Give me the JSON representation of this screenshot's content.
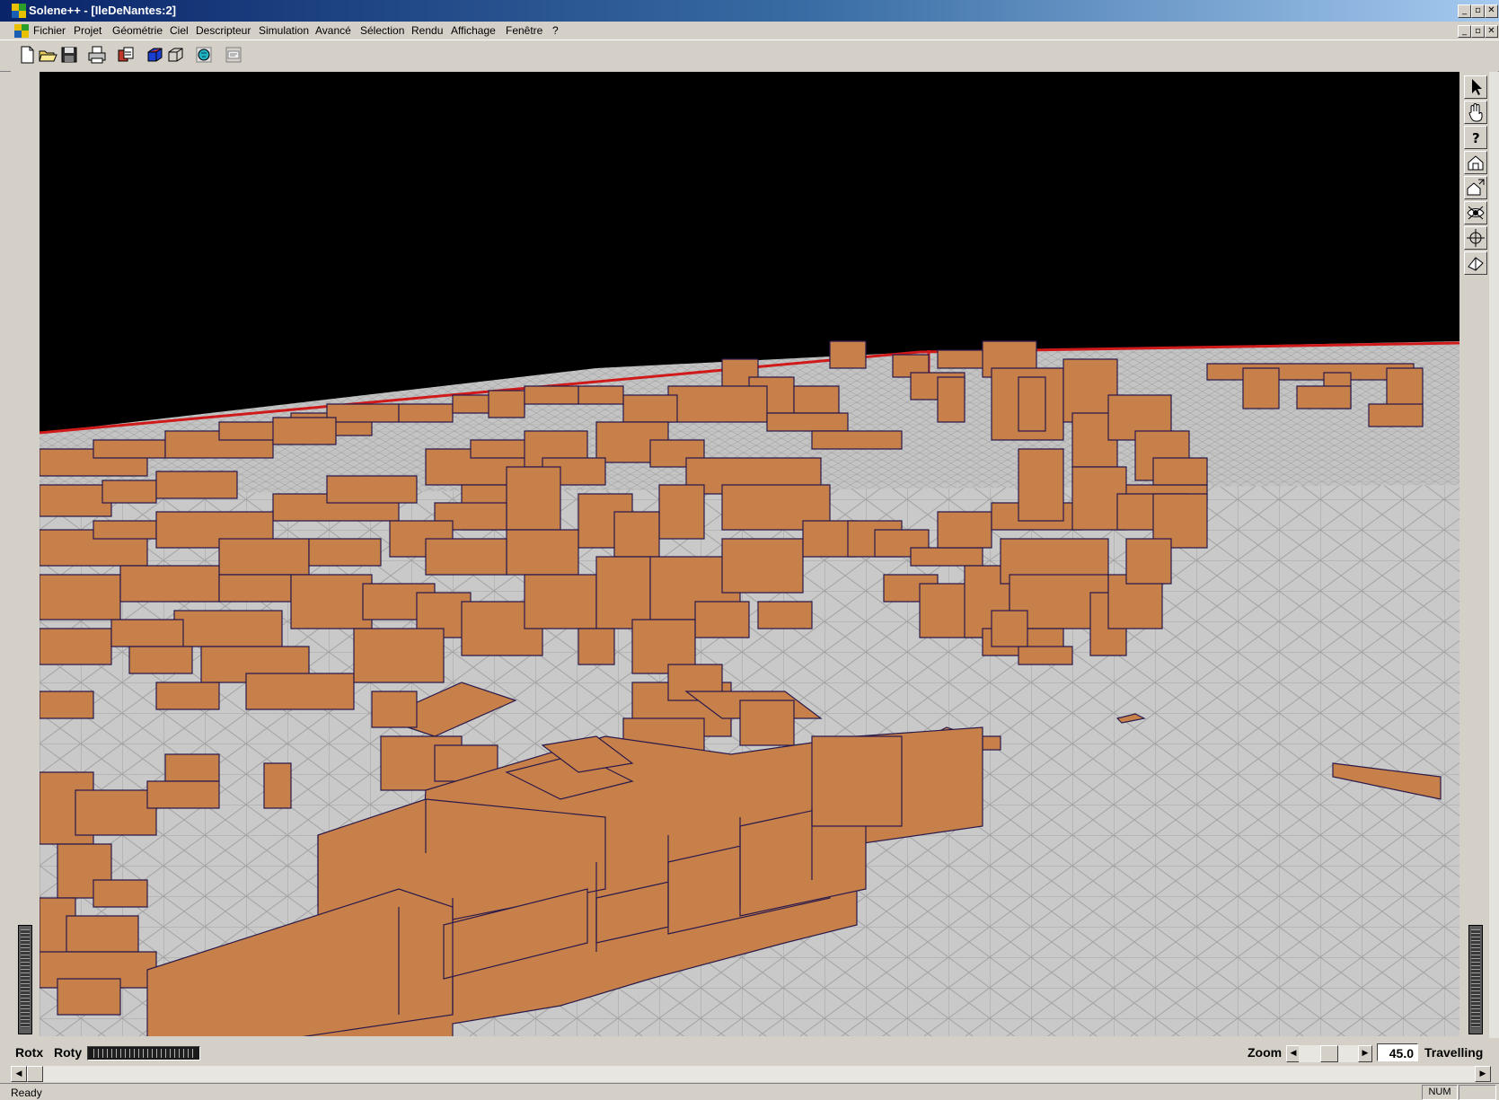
{
  "window": {
    "title": "Solene++ - [IleDeNantes:2]"
  },
  "menu": [
    "Fichier",
    "Projet",
    "Géométrie",
    "Ciel",
    "Descripteur",
    "Simulation",
    "Avancé",
    "Sélection",
    "Rendu",
    "Affichage",
    "Fenêtre",
    "?"
  ],
  "toolbar": {
    "icons": [
      "new-file-icon",
      "open-folder-icon",
      "save-icon",
      "print-icon",
      "import-icon",
      "solid-cube-icon",
      "wireframe-cube-icon",
      "sky-globe-icon",
      "properties-icon"
    ]
  },
  "palette": {
    "icons": [
      "pointer-arrow-icon",
      "pan-hand-icon",
      "help-question-icon",
      "home-view-icon",
      "home-zoom-icon",
      "eye-view-icon",
      "move-cross-icon",
      "perspective-icon"
    ]
  },
  "viewport": {
    "scene": "3D urban model with terrain mesh",
    "colors": {
      "sky": "#000000",
      "ground": "#c8c8c8",
      "mesh": "#a9a9a9",
      "buildings": "#c8804a",
      "building_edges": "#2a1a4a",
      "horizon": "#d01a1a"
    }
  },
  "controls": {
    "rotx_label": "Rotx",
    "roty_label": "Roty",
    "zoom_label": "Zoom",
    "zoom_value": "45.0",
    "mode_label": "Travelling"
  },
  "status": {
    "text": "Ready",
    "num": "NUM"
  }
}
